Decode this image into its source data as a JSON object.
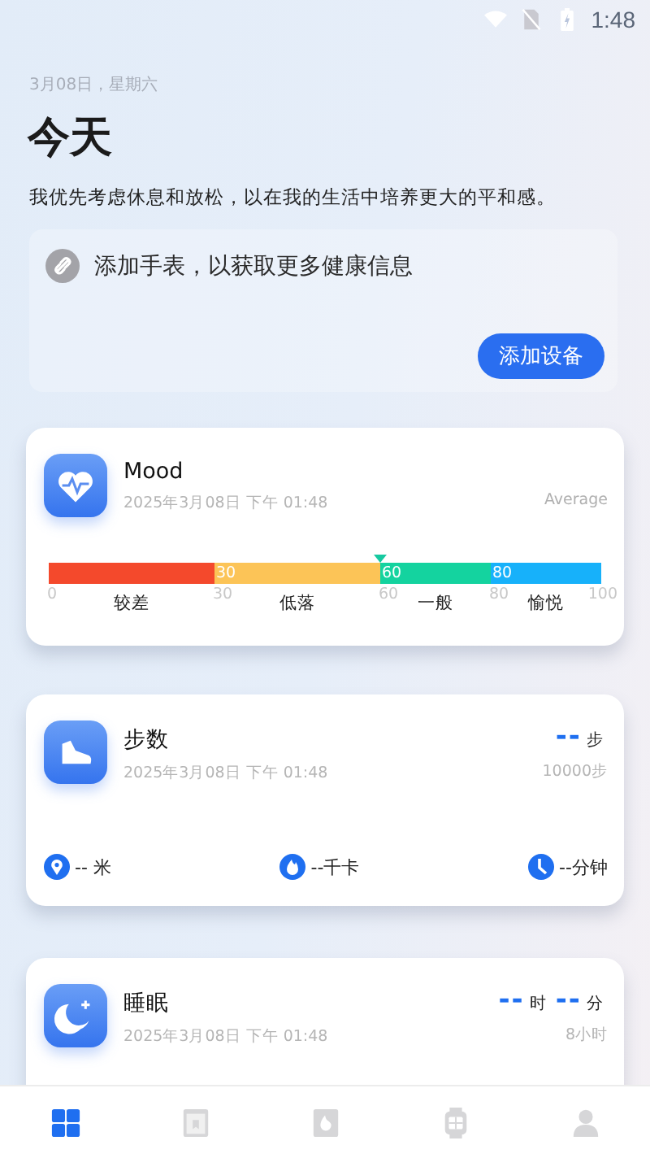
{
  "status_bar": {
    "time": "1:48"
  },
  "header": {
    "date": "3月08日，星期六",
    "title": "今天",
    "subtitle": "我优先考虑休息和放松，以在我的生活中培养更大的平和感。"
  },
  "watch_prompt": {
    "message": "添加手表，以获取更多健康信息",
    "button": "添加设备"
  },
  "mood": {
    "title": "Mood",
    "timestamp": "2025年3月08日 下午 01:48",
    "summary": "Average",
    "marker": {
      "level": 0.6
    },
    "segments": [
      {
        "label": "较差",
        "color": "#f4492c",
        "start_tick": "0"
      },
      {
        "label": "低落",
        "color": "#fcc457",
        "start_tick": "30",
        "bar_label": "30"
      },
      {
        "label": "一般",
        "color": "#14d39f",
        "start_tick": "60",
        "bar_label": "60"
      },
      {
        "label": "愉悦",
        "color": "#17b1fa",
        "start_tick": "80",
        "bar_label": "80"
      }
    ],
    "end_tick": "100"
  },
  "steps": {
    "title": "步数",
    "timestamp": "2025年3月08日 下午 01:48",
    "value": "--",
    "unit": "步",
    "goal": "10000步",
    "stats": [
      {
        "kind": "location",
        "text": "-- 米"
      },
      {
        "kind": "flame",
        "text": "--千卡"
      },
      {
        "kind": "clock",
        "text": "--分钟"
      }
    ]
  },
  "sleep": {
    "title": "睡眠",
    "timestamp": "2025年3月08日 下午 01:48",
    "hours": "--",
    "hours_unit": "时",
    "minutes": "--",
    "minutes_unit": "分",
    "goal": "8小时"
  },
  "nav": [
    {
      "kind": "grid",
      "selected": true
    },
    {
      "kind": "bookmark",
      "selected": false
    },
    {
      "kind": "flame",
      "selected": false
    },
    {
      "kind": "watch",
      "selected": false
    },
    {
      "kind": "person",
      "selected": false
    }
  ]
}
